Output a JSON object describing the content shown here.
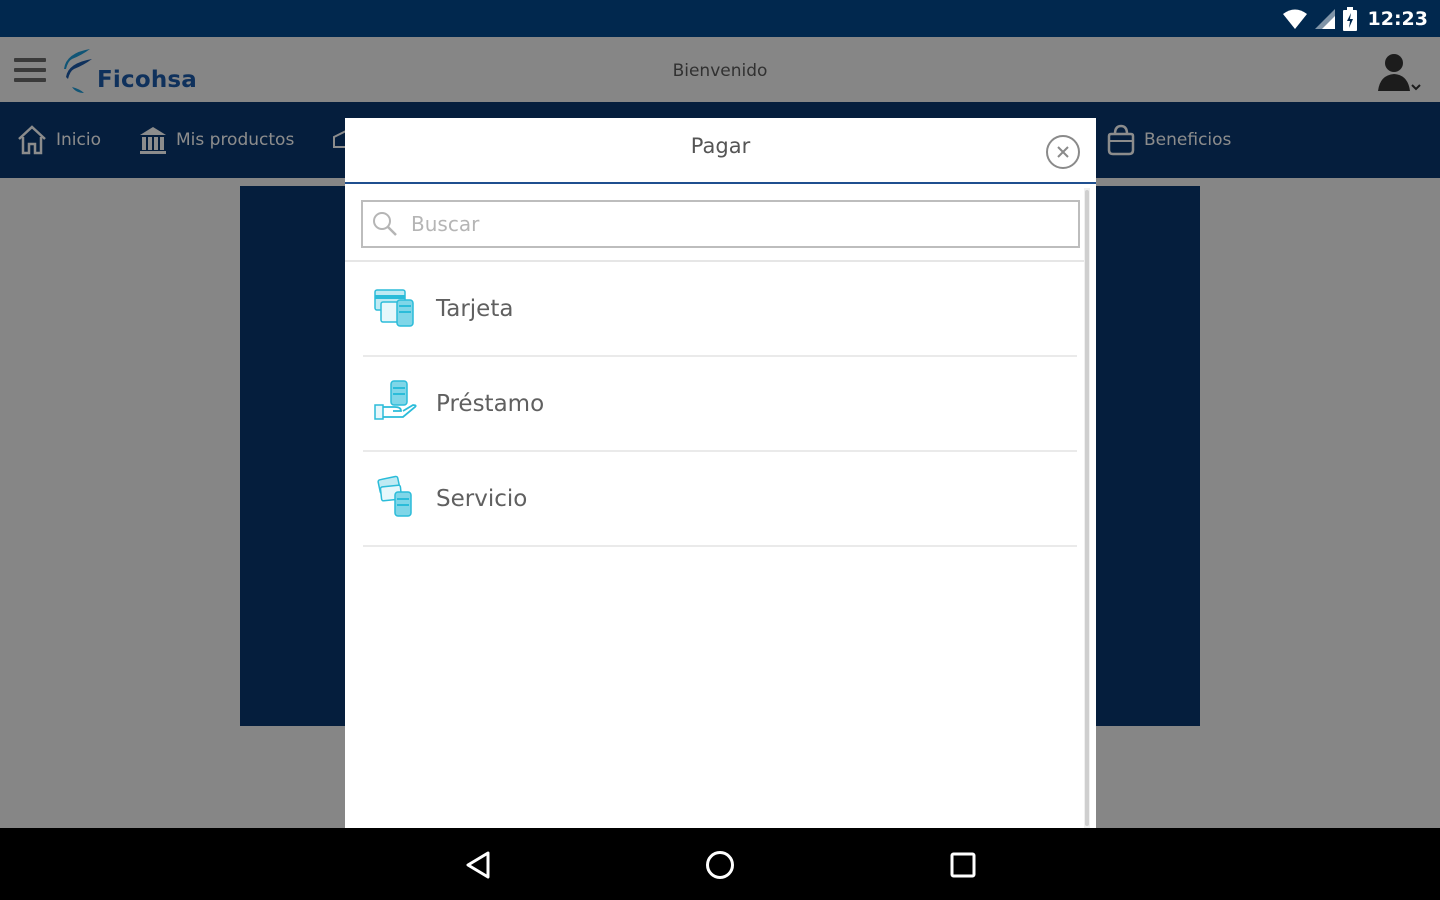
{
  "status_bar": {
    "time": "12:23"
  },
  "header": {
    "brand": "Ficohsa",
    "title": "Bienvenido",
    "brand_color": "#1c5aa8"
  },
  "nav": {
    "items": [
      {
        "label": "Inicio",
        "icon": "home-icon"
      },
      {
        "label": "Mis productos",
        "icon": "bank-icon"
      },
      {
        "label": "Beneficios",
        "icon": "bag-icon"
      }
    ],
    "background": "#0a3870"
  },
  "modal": {
    "title": "Pagar",
    "search_placeholder": "Buscar",
    "accent_color": "#2bbcd9",
    "items": [
      {
        "label": "Tarjeta",
        "icon": "card-icon"
      },
      {
        "label": "Préstamo",
        "icon": "loan-icon"
      },
      {
        "label": "Servicio",
        "icon": "service-icon"
      }
    ]
  }
}
